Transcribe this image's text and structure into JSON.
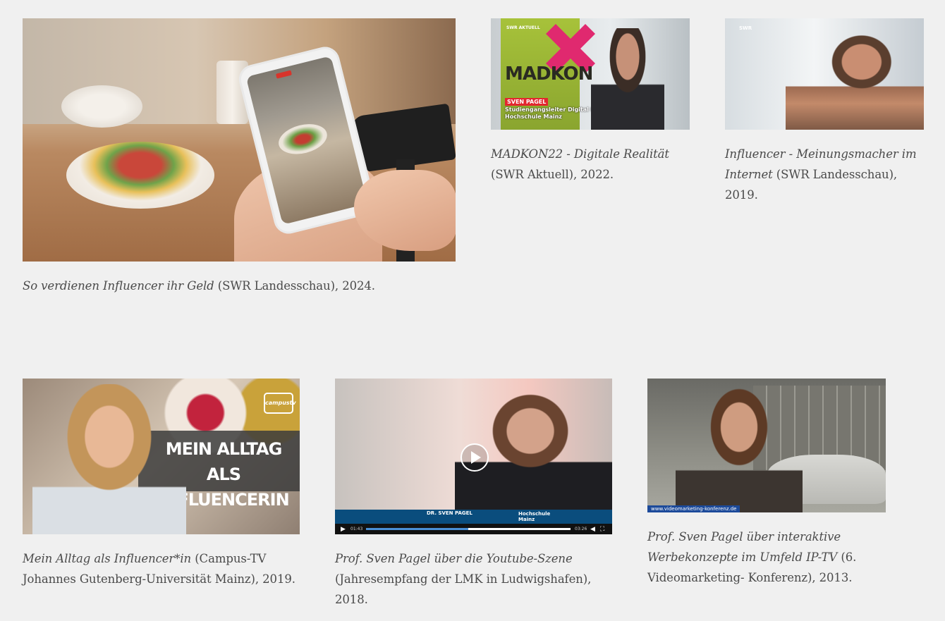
{
  "items": [
    {
      "title": "So verdienen Influencer ihr Geld",
      "source": " (SWR Landesschau), 2024."
    },
    {
      "title": "MADKON22 - Digitale Realität",
      "source": " (SWR Aktuell), 2022.",
      "thumb": {
        "banner_brand": "SWR AKTUELL",
        "banner_title": "MADKON",
        "name_tag": "SVEN PAGEL",
        "subtitle_line1": "Studiengangsleiter Digital Media",
        "subtitle_line2": "Hochschule Mainz"
      }
    },
    {
      "title": "Influencer - Meinungsmacher im Internet",
      "source": " (SWR Landesschau), 2019.",
      "thumb": {
        "logo": "SWR"
      }
    },
    {
      "title": "Mein Alltag als Influencer*in",
      "source": " (Campus-TV Johannes Gutenberg-Universität Mainz), 2019.",
      "thumb": {
        "overlay_line1": "MEIN ALLTAG ALS",
        "overlay_line2": "INFLUENCERIN",
        "channel_logo": "campustv"
      }
    },
    {
      "title": "Prof. Sven Pagel über die Youtube-Szene",
      "source": " (Jahresempfang der LMK in Ludwigshafen), 2018.",
      "thumb": {
        "lower_third_line1": "DR. SVEN PAGEL",
        "lower_third_line2": "Hochschule Mainz",
        "time_elapsed": "01:43",
        "time_total": "03:26",
        "progress_fraction": 0.5
      }
    },
    {
      "title": "Prof. Sven Pagel über interaktive Werbekonzepte im Umfeld IP-TV",
      "source": " (6. Videomarketing- Konferenz), 2013.",
      "thumb": {
        "url_overlay": "www.videomarketing-konferenz.de"
      }
    }
  ]
}
